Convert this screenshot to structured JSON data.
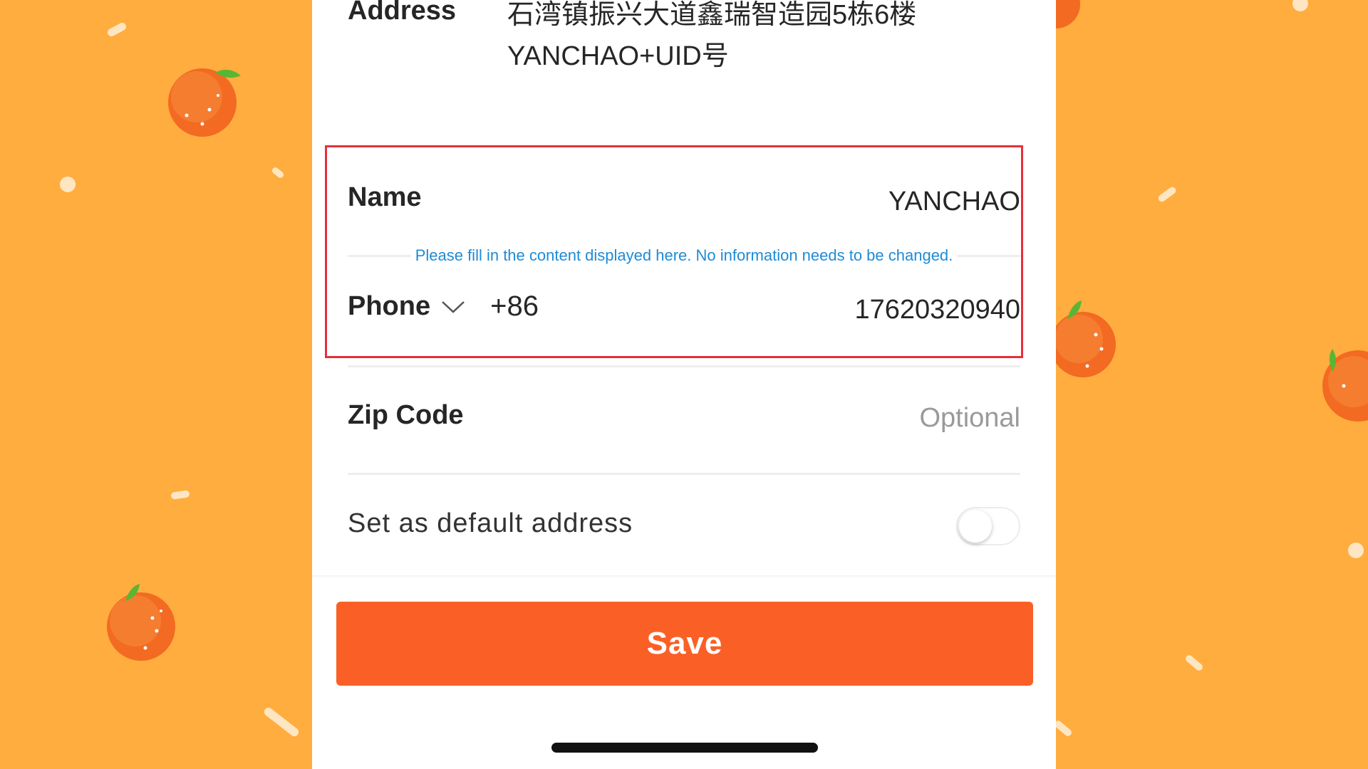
{
  "address": {
    "label": "Address",
    "line1": "石湾镇振兴大道鑫瑞智造园5栋6楼",
    "line2": "YANCHAO+UID号"
  },
  "name": {
    "label": "Name",
    "value": "YANCHAO"
  },
  "hint": {
    "text": "Please fill in the content displayed here. No information needs to be changed."
  },
  "phone": {
    "label": "Phone",
    "country_code": "+86",
    "number": "17620320940"
  },
  "zip": {
    "label": "Zip Code",
    "placeholder": "Optional"
  },
  "default_address": {
    "label": "Set as default address",
    "enabled": false
  },
  "save": {
    "label": "Save"
  },
  "colors": {
    "background": "#ffad3f",
    "accent": "#fa6026",
    "highlight_border": "#e5303a",
    "hint_text": "#1e8bd6"
  }
}
